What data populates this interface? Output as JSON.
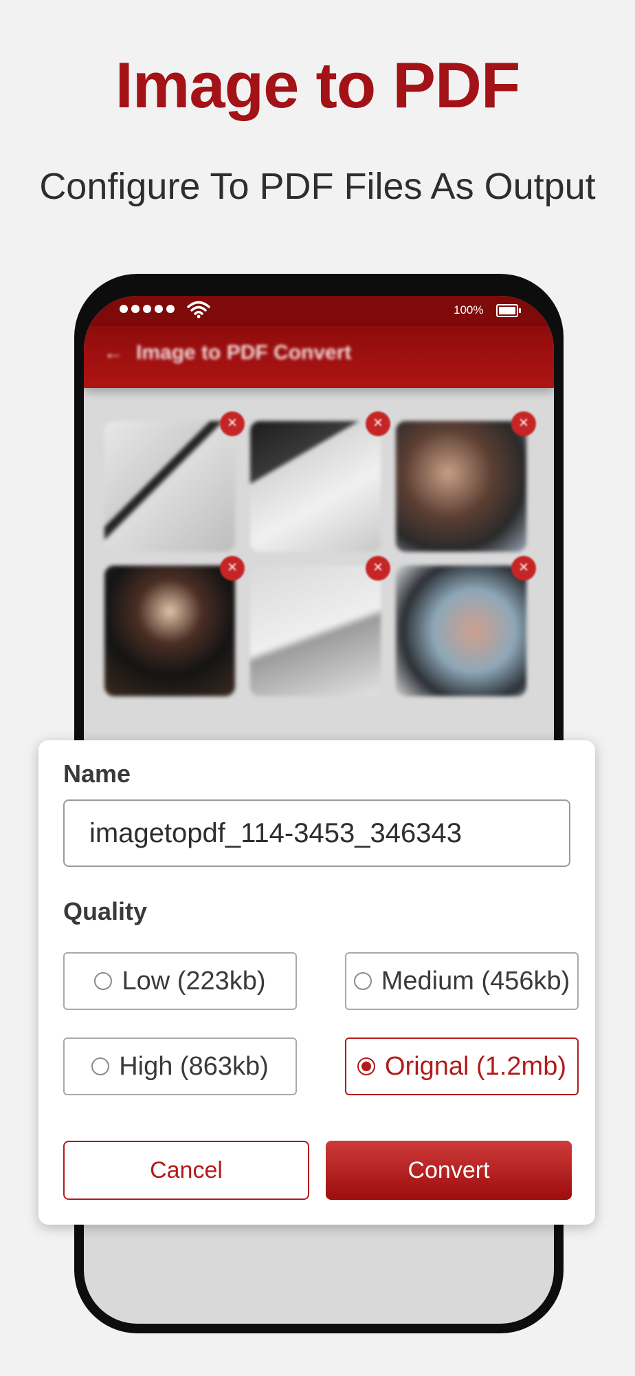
{
  "hero": {
    "title": "Image to PDF",
    "subtitle": "Configure To PDF Files As Output"
  },
  "statusbar": {
    "battery_percent": "100%",
    "signal_icon": "signal-dots-icon",
    "wifi_icon": "wifi-icon",
    "battery_icon": "battery-icon"
  },
  "appbar": {
    "back_icon": "arrow-left-icon",
    "title": "Image to PDF  Convert"
  },
  "thumbnails": [
    {
      "subject": "documents-with-pen"
    },
    {
      "subject": "papers-on-desk"
    },
    {
      "subject": "team-meeting"
    },
    {
      "subject": "woman-portrait"
    },
    {
      "subject": "signing-document"
    },
    {
      "subject": "people-reviewing-charts"
    }
  ],
  "dialog": {
    "name_label": "Name",
    "name_value": "imagetopdf_114-3453_346343",
    "quality_label": "Quality",
    "options": [
      {
        "label": "Low (223kb)",
        "selected": false
      },
      {
        "label": "Medium (456kb)",
        "selected": false
      },
      {
        "label": "High (863kb)",
        "selected": false
      },
      {
        "label": "Orignal (1.2mb)",
        "selected": true
      }
    ],
    "cancel_label": "Cancel",
    "convert_label": "Convert"
  },
  "colors": {
    "brand": "#a31217",
    "selected": "#b31b1b"
  }
}
